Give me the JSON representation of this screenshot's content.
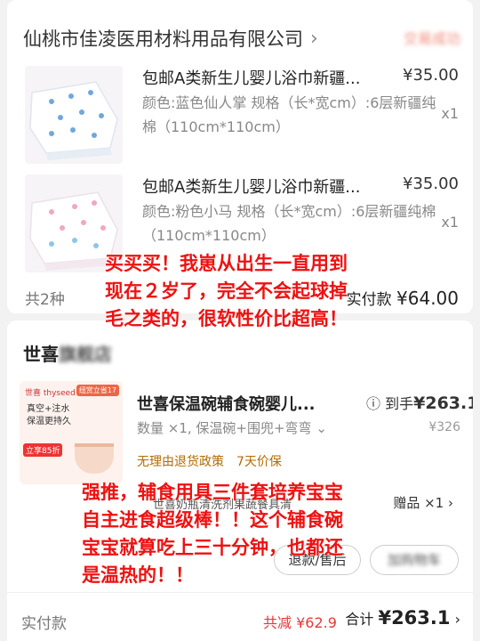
{
  "order1": {
    "shop_name": "仙桃市佳凌医用材料用品有限公司",
    "status": "交易成功",
    "items": [
      {
        "title": "包邮A类新生儿婴儿浴巾新疆...",
        "price": "¥35.00",
        "spec": "颜色:蓝色仙人掌 规格（长*宽cm）:6层新疆纯棉（110cm*110cm）",
        "qty": "x1"
      },
      {
        "title": "包邮A类新生儿婴儿浴巾新疆...",
        "price": "¥35.00",
        "spec": "颜色:粉色小马 规格（长*宽cm）:6层新疆纯棉（110cm*110cm）",
        "qty": "x1"
      }
    ],
    "count_label": "共2种",
    "paid_label": "实付款",
    "paid_amount": "¥64.00"
  },
  "review1": "买买买！我崽从出生一直用到现在２岁了，完全不会起球掉毛之类的，很软性价比超高！",
  "order2": {
    "shop_name": "世喜",
    "shop_name_blurred": "旗舰店",
    "thumb": {
      "brand": "世喜 thyseed",
      "tag": "纽赏立省17",
      "line1": "真空+注水",
      "line2": "保温更持久",
      "badge": "立享85折"
    },
    "title": "世喜保温碗辅食碗婴儿...",
    "price_label": "到手",
    "price": "¥263.1",
    "spec": "数量 ×1, 保温碗+围兜+弯弯",
    "orig_price": "¥326",
    "policy": "无理由退货政策　7天价保",
    "gift_name": "世喜奶瓶清洗剂果蔬餐具清",
    "gift_tag": "赠品 ×1",
    "btn_refund": "退款/售后",
    "btn_cart": "加购物车",
    "paid_label": "实付款",
    "discount": "共减 ¥62.9",
    "total_label": "合计",
    "total_amount": "¥263.1"
  },
  "review2": "强推，辅食用具三件套培养宝宝自主进食超级棒！！这个辅食碗宝宝就算吃上三十分钟，也都还是温热的！！",
  "colors": {
    "accent": "#e4393c",
    "overlay_text": "#ee1111",
    "muted": "#888888"
  }
}
